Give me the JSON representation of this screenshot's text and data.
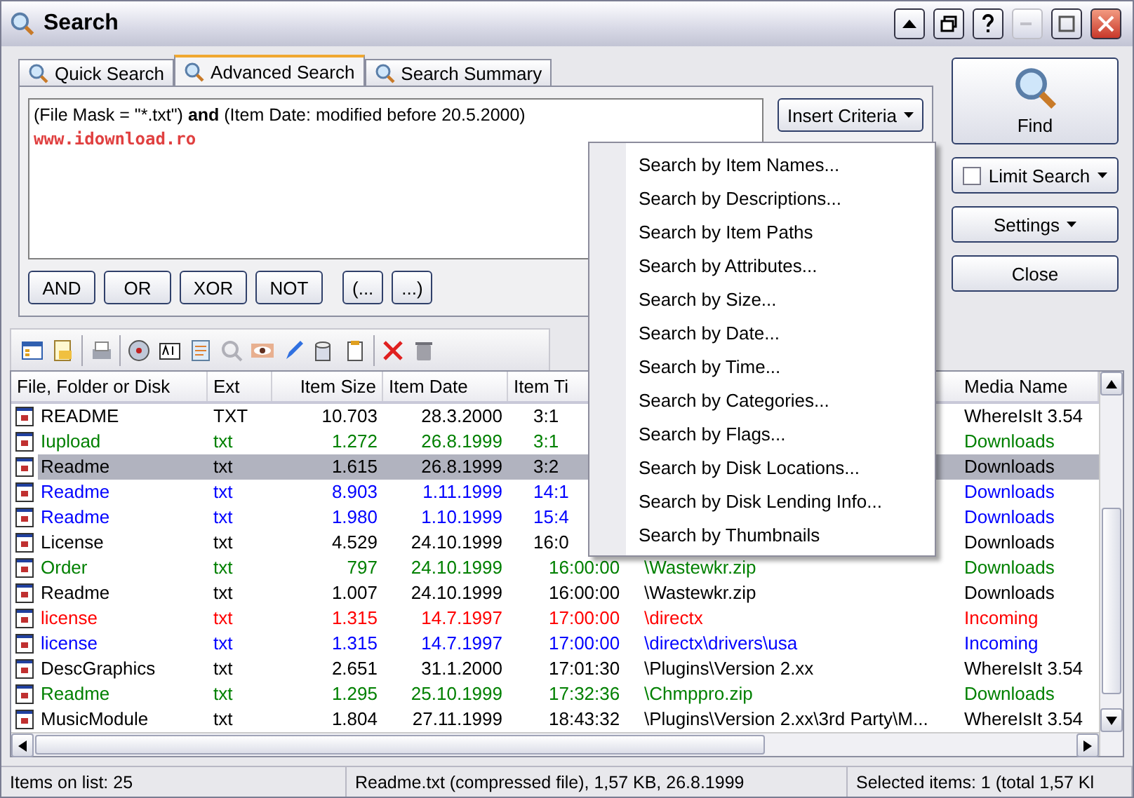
{
  "window": {
    "title": "Search"
  },
  "tabs": [
    {
      "label": "Quick Search",
      "selected": false
    },
    {
      "label": "Advanced Search",
      "selected": true
    },
    {
      "label": "Search Summary",
      "selected": false
    }
  ],
  "query": {
    "before": "(File Mask = \"*.txt\") ",
    "operator": "and",
    "after": " (Item Date: modified before 20.5.2000)",
    "watermark_line": "www.idownload.ro"
  },
  "insert_criteria": "Insert Criteria",
  "operator_buttons": [
    "AND",
    "OR",
    "XOR",
    "NOT",
    "(...",
    "...)"
  ],
  "side_buttons": {
    "find": "Find",
    "limit_search": {
      "label": "Limit Search",
      "checked": false
    },
    "settings": "Settings",
    "close": "Close"
  },
  "criteria_menu": [
    "Search by Item Names...",
    "Search by Descriptions...",
    "Search by Item Paths",
    "Search by Attributes...",
    "Search by Size...",
    "Search by Date...",
    "Search by Time...",
    "Search by Categories...",
    "Search by Flags...",
    "Search by Disk Locations...",
    "Search by Disk Lending Info...",
    "Search by Thumbnails"
  ],
  "table": {
    "columns": [
      "File, Folder or Disk",
      "Ext",
      "Item Size",
      "Item Date",
      "Item Ti",
      "Media Name"
    ],
    "rows": [
      {
        "name": "README",
        "ext": "TXT",
        "size": "10.703",
        "date": "28.3.2000",
        "time": "3:1",
        "media": "WhereIsIt 3.54",
        "color": "#000000",
        "selected": false
      },
      {
        "name": "Iupload",
        "ext": "txt",
        "size": "1.272",
        "date": "26.8.1999",
        "time": "3:1",
        "media": "Downloads",
        "color": "#008000",
        "selected": false
      },
      {
        "name": "Readme",
        "ext": "txt",
        "size": "1.615",
        "date": "26.8.1999",
        "time": "3:2",
        "media": "Downloads",
        "color": "#000000",
        "selected": true
      },
      {
        "name": "Readme",
        "ext": "txt",
        "size": "8.903",
        "date": "1.11.1999",
        "time": "14:1",
        "media": "Downloads",
        "color": "#0000ff",
        "selected": false
      },
      {
        "name": "Readme",
        "ext": "txt",
        "size": "1.980",
        "date": "1.10.1999",
        "time": "15:4",
        "media": "Downloads",
        "color": "#0000ff",
        "selected": false
      },
      {
        "name": "License",
        "ext": "txt",
        "size": "4.529",
        "date": "24.10.1999",
        "time": "16:0",
        "media": "Downloads",
        "color": "#000000",
        "selected": false
      },
      {
        "name": "Order",
        "ext": "txt",
        "size": "797",
        "date": "24.10.1999",
        "time": "16:00:00",
        "path": "\\Wastewkr.zip",
        "media": "Downloads",
        "color": "#008000",
        "selected": false
      },
      {
        "name": "Readme",
        "ext": "txt",
        "size": "1.007",
        "date": "24.10.1999",
        "time": "16:00:00",
        "path": "\\Wastewkr.zip",
        "media": "Downloads",
        "color": "#000000",
        "selected": false
      },
      {
        "name": "license",
        "ext": "txt",
        "size": "1.315",
        "date": "14.7.1997",
        "time": "17:00:00",
        "path": "\\directx",
        "media": "Incoming",
        "color": "#ff0000",
        "selected": false
      },
      {
        "name": "license",
        "ext": "txt",
        "size": "1.315",
        "date": "14.7.1997",
        "time": "17:00:00",
        "path": "\\directx\\drivers\\usa",
        "media": "Incoming",
        "color": "#0000ff",
        "selected": false
      },
      {
        "name": "DescGraphics",
        "ext": "txt",
        "size": "2.651",
        "date": "31.1.2000",
        "time": "17:01:30",
        "path": "\\Plugins\\Version 2.xx",
        "media": "WhereIsIt 3.54",
        "color": "#000000",
        "selected": false
      },
      {
        "name": "Readme",
        "ext": "txt",
        "size": "1.295",
        "date": "25.10.1999",
        "time": "17:32:36",
        "path": "\\Chmppro.zip",
        "media": "Downloads",
        "color": "#008000",
        "selected": false
      },
      {
        "name": "MusicModule",
        "ext": "txt",
        "size": "1.804",
        "date": "27.11.1999",
        "time": "18:43:32",
        "path": "\\Plugins\\Version 2.xx\\3rd Party\\M...",
        "media": "WhereIsIt 3.54",
        "color": "#000000",
        "selected": false
      }
    ]
  },
  "status_bar": [
    "Items on list: 25",
    "Readme.txt (compressed file), 1,57 KB, 26.8.1999",
    "Selected items: 1 (total 1,57 Kl"
  ]
}
